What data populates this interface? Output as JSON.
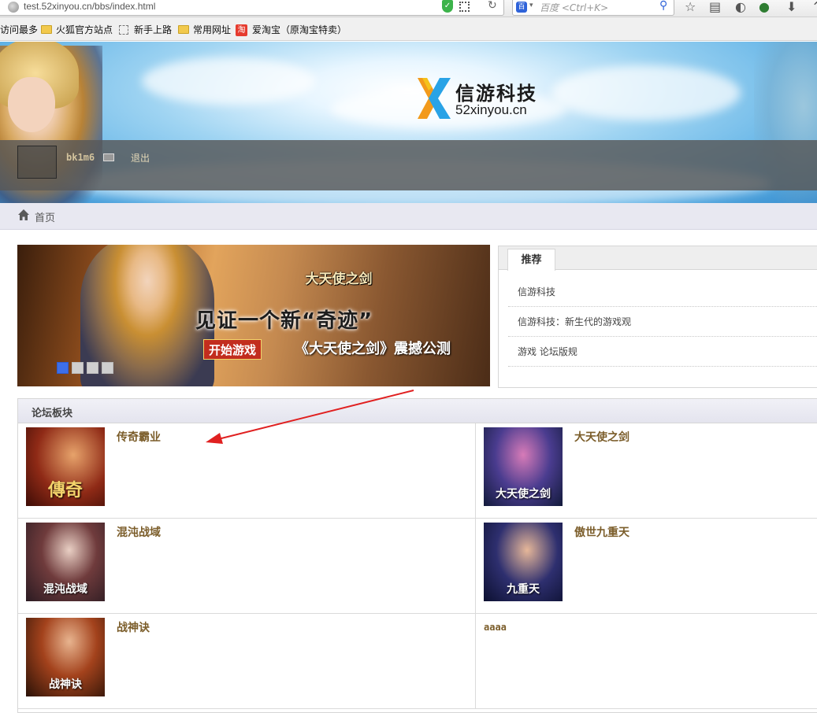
{
  "browser": {
    "url": "test.52xinyou.cn/bbs/index.html",
    "search_placeholder": "百度 <Ctrl+K>",
    "search_engine_icon": "baidu-paw-icon",
    "bookmarks": [
      {
        "label": "访问最多"
      },
      {
        "label": "火狐官方站点",
        "icon": "folder-icon"
      },
      {
        "label": "新手上路",
        "icon": "dashed-page-icon"
      },
      {
        "label": "常用网址",
        "icon": "folder-icon"
      },
      {
        "label": "爱淘宝（原淘宝特卖）",
        "icon": "taobao-icon",
        "icon_glyph": "淘"
      }
    ]
  },
  "header": {
    "logo_cn": "信游科技",
    "logo_en": "52xinyou.cn",
    "username": "bk1m6",
    "logout": "退出"
  },
  "breadcrumb": {
    "home": "首页"
  },
  "carousel": {
    "game_title": "大天使之剑",
    "slogan": "见证一个新“奇迹”",
    "start_button": "开始游戏",
    "subtitle": "《大天使之剑》震撼公测",
    "slides": 4,
    "active_slide": 1,
    "active_color": "#3d6fe8"
  },
  "recommend": {
    "tab": "推荐",
    "items": [
      {
        "label": "信游科技"
      },
      {
        "label": "信游科技：新生代的游戏观"
      },
      {
        "label": "游戏 论坛版规"
      }
    ]
  },
  "forum": {
    "title": "论坛板块",
    "title_color": "#7b5d2a",
    "boards": [
      {
        "name": "传奇霸业",
        "thumb_text": "傳奇"
      },
      {
        "name": "大天使之剑",
        "thumb_text": "大天使之剑"
      },
      {
        "name": "混沌战域",
        "thumb_text": "混沌战域"
      },
      {
        "name": "傲世九重天",
        "thumb_text": "九重天"
      },
      {
        "name": "战神诀",
        "thumb_text": "战神诀"
      },
      {
        "name": "aaaa"
      }
    ]
  },
  "annotation": {
    "arrow_color": "#e02020"
  }
}
